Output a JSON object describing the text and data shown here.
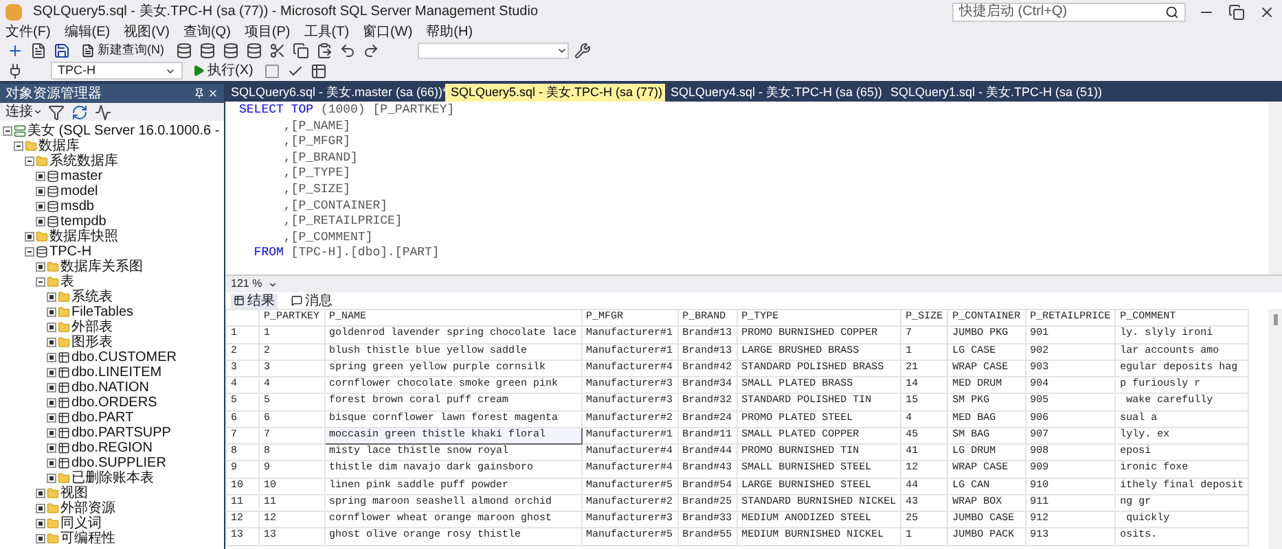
{
  "window": {
    "title": "SQLQuery5.sql - 美女.TPC-H (sa (77)) - Microsoft SQL Server Management Studio",
    "quick_launch": {
      "placeholder": "快捷启动 (Ctrl+Q)"
    }
  },
  "menu": [
    "文件(F)",
    "编辑(E)",
    "视图(V)",
    "查询(Q)",
    "项目(P)",
    "工具(T)",
    "窗口(W)",
    "帮助(H)"
  ],
  "toolbar": {
    "new_query": "新建查询(N)",
    "database": "TPC-H",
    "execute": "执行(X)"
  },
  "object_explorer": {
    "title": "对象资源管理器",
    "connect": "连接",
    "tree": [
      {
        "label": "美女 (SQL Server 16.0.1000.6 -",
        "kind": "server",
        "expanded": true,
        "children": [
          {
            "label": "数据库",
            "kind": "folder",
            "expanded": true,
            "children": [
              {
                "label": "系统数据库",
                "kind": "folder",
                "expanded": true,
                "children": [
                  {
                    "label": "master",
                    "kind": "database",
                    "expanded": false
                  },
                  {
                    "label": "model",
                    "kind": "database",
                    "expanded": false
                  },
                  {
                    "label": "msdb",
                    "kind": "database",
                    "expanded": false
                  },
                  {
                    "label": "tempdb",
                    "kind": "database",
                    "expanded": false
                  }
                ]
              },
              {
                "label": "数据库快照",
                "kind": "folder",
                "expanded": false
              },
              {
                "label": "TPC-H",
                "kind": "database",
                "expanded": true,
                "children": [
                  {
                    "label": "数据库关系图",
                    "kind": "folder",
                    "expanded": false
                  },
                  {
                    "label": "表",
                    "kind": "folder",
                    "expanded": true,
                    "children": [
                      {
                        "label": "系统表",
                        "kind": "folder",
                        "expanded": false
                      },
                      {
                        "label": "FileTables",
                        "kind": "folder",
                        "expanded": false
                      },
                      {
                        "label": "外部表",
                        "kind": "folder",
                        "expanded": false
                      },
                      {
                        "label": "图形表",
                        "kind": "folder",
                        "expanded": false
                      },
                      {
                        "label": "dbo.CUSTOMER",
                        "kind": "table",
                        "expanded": false
                      },
                      {
                        "label": "dbo.LINEITEM",
                        "kind": "table",
                        "expanded": false
                      },
                      {
                        "label": "dbo.NATION",
                        "kind": "table",
                        "expanded": false
                      },
                      {
                        "label": "dbo.ORDERS",
                        "kind": "table",
                        "expanded": false
                      },
                      {
                        "label": "dbo.PART",
                        "kind": "table",
                        "expanded": false
                      },
                      {
                        "label": "dbo.PARTSUPP",
                        "kind": "table",
                        "expanded": false
                      },
                      {
                        "label": "dbo.REGION",
                        "kind": "table",
                        "expanded": false
                      },
                      {
                        "label": "dbo.SUPPLIER",
                        "kind": "table",
                        "expanded": false
                      },
                      {
                        "label": "已删除账本表",
                        "kind": "folder",
                        "expanded": false
                      }
                    ]
                  },
                  {
                    "label": "视图",
                    "kind": "folder",
                    "expanded": false
                  },
                  {
                    "label": "外部资源",
                    "kind": "folder",
                    "expanded": false
                  },
                  {
                    "label": "同义词",
                    "kind": "folder",
                    "expanded": false
                  },
                  {
                    "label": "可编程性",
                    "kind": "folder",
                    "expanded": false
                  }
                ]
              }
            ]
          }
        ]
      }
    ]
  },
  "tabs": [
    {
      "label": "SQLQuery6.sql - 美女.master (sa (66))*",
      "selected": false
    },
    {
      "label": "SQLQuery5.sql - 美女.TPC-H (sa (77))",
      "selected": true
    },
    {
      "label": "SQLQuery4.sql - 美女.TPC-H (sa (65))",
      "selected": false
    },
    {
      "label": "SQLQuery1.sql - 美女.TPC-H (sa (51))",
      "selected": false
    }
  ],
  "editor": {
    "lines": [
      [
        {
          "text": "SELECT TOP",
          "kind": "keyword"
        },
        {
          "text": " (1000) [P_PARTKEY]",
          "kind": "plain"
        }
      ],
      [
        {
          "text": "      ,[P_NAME]",
          "kind": "plain"
        }
      ],
      [
        {
          "text": "      ,[P_MFGR]",
          "kind": "plain"
        }
      ],
      [
        {
          "text": "      ,[P_BRAND]",
          "kind": "plain"
        }
      ],
      [
        {
          "text": "      ,[P_TYPE]",
          "kind": "plain"
        }
      ],
      [
        {
          "text": "      ,[P_SIZE]",
          "kind": "plain"
        }
      ],
      [
        {
          "text": "      ,[P_CONTAINER]",
          "kind": "plain"
        }
      ],
      [
        {
          "text": "      ,[P_RETAILPRICE]",
          "kind": "plain"
        }
      ],
      [
        {
          "text": "      ,[P_COMMENT]",
          "kind": "plain"
        }
      ],
      [
        {
          "text": "  FROM",
          "kind": "keyword"
        },
        {
          "text": " [TPC-H].[dbo].[PART]",
          "kind": "plain"
        }
      ]
    ],
    "zoom": "121 %"
  },
  "results": {
    "tabs": [
      {
        "label": "结果",
        "selected": true
      },
      {
        "label": "消息",
        "selected": false
      }
    ],
    "columns": [
      "P_PARTKEY",
      "P_NAME",
      "P_MFGR",
      "P_BRAND",
      "P_TYPE",
      "P_SIZE",
      "P_CONTAINER",
      "P_RETAILPRICE",
      "P_COMMENT"
    ],
    "rows": [
      {
        "number": "1",
        "selected": false,
        "cells": [
          "1",
          "goldenrod lavender spring chocolate lace",
          "Manufacturer#1",
          "Brand#13",
          "PROMO BURNISHED COPPER",
          "7",
          "JUMBO PKG",
          "901",
          "ly. slyly ironi"
        ]
      },
      {
        "number": "2",
        "selected": false,
        "cells": [
          "2",
          "blush thistle blue yellow saddle",
          "Manufacturer#1",
          "Brand#13",
          "LARGE BRUSHED BRASS",
          "1",
          "LG CASE",
          "902",
          "lar accounts amo"
        ]
      },
      {
        "number": "3",
        "selected": false,
        "cells": [
          "3",
          "spring green yellow purple cornsilk",
          "Manufacturer#4",
          "Brand#42",
          "STANDARD POLISHED BRASS",
          "21",
          "WRAP CASE",
          "903",
          "egular deposits hag"
        ]
      },
      {
        "number": "4",
        "selected": false,
        "cells": [
          "4",
          "cornflower chocolate smoke green pink",
          "Manufacturer#3",
          "Brand#34",
          "SMALL PLATED BRASS",
          "14",
          "MED DRUM",
          "904",
          "p furiously r"
        ]
      },
      {
        "number": "5",
        "selected": false,
        "cells": [
          "5",
          "forest brown coral puff cream",
          "Manufacturer#3",
          "Brand#32",
          "STANDARD POLISHED TIN",
          "15",
          "SM PKG",
          "905",
          " wake carefully"
        ]
      },
      {
        "number": "6",
        "selected": false,
        "cells": [
          "6",
          "bisque cornflower lawn forest magenta",
          "Manufacturer#2",
          "Brand#24",
          "PROMO PLATED STEEL",
          "4",
          "MED BAG",
          "906",
          "sual a"
        ]
      },
      {
        "number": "7",
        "selected": true,
        "cells": [
          "7",
          "moccasin green thistle khaki floral",
          "Manufacturer#1",
          "Brand#11",
          "SMALL PLATED COPPER",
          "45",
          "SM BAG",
          "907",
          "lyly. ex"
        ]
      },
      {
        "number": "8",
        "selected": false,
        "cells": [
          "8",
          "misty lace thistle snow royal",
          "Manufacturer#4",
          "Brand#44",
          "PROMO BURNISHED TIN",
          "41",
          "LG DRUM",
          "908",
          "eposi"
        ]
      },
      {
        "number": "9",
        "selected": false,
        "cells": [
          "9",
          "thistle dim navajo dark gainsboro",
          "Manufacturer#4",
          "Brand#43",
          "SMALL BURNISHED STEEL",
          "12",
          "WRAP CASE",
          "909",
          "ironic foxe"
        ]
      },
      {
        "number": "10",
        "selected": false,
        "cells": [
          "10",
          "linen pink saddle puff powder",
          "Manufacturer#5",
          "Brand#54",
          "LARGE BURNISHED STEEL",
          "44",
          "LG CAN",
          "910",
          "ithely final deposit"
        ]
      },
      {
        "number": "11",
        "selected": false,
        "cells": [
          "11",
          "spring maroon seashell almond orchid",
          "Manufacturer#2",
          "Brand#25",
          "STANDARD BURNISHED NICKEL",
          "43",
          "WRAP BOX",
          "911",
          "ng gr"
        ]
      },
      {
        "number": "12",
        "selected": false,
        "cells": [
          "12",
          "cornflower wheat orange maroon ghost",
          "Manufacturer#3",
          "Brand#33",
          "MEDIUM ANODIZED STEEL",
          "25",
          "JUMBO CASE",
          "912",
          " quickly"
        ]
      },
      {
        "number": "13",
        "selected": false,
        "cells": [
          "13",
          "ghost olive orange rosy thistle",
          "Manufacturer#5",
          "Brand#55",
          "MEDIUM BURNISHED NICKEL",
          "1",
          "JUMBO PACK",
          "913",
          "osits."
        ]
      }
    ]
  }
}
